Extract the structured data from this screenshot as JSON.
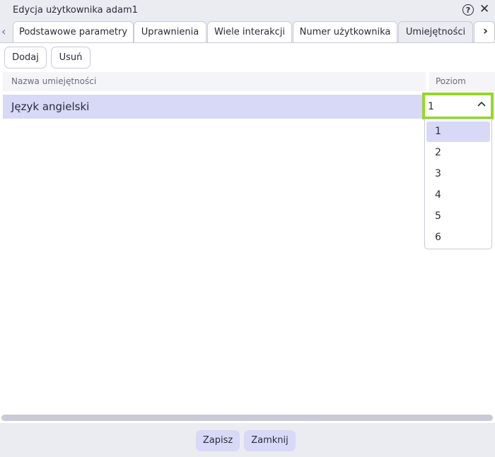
{
  "window": {
    "title": "Edycja użytkownika adam1",
    "help_glyph": "?",
    "close_glyph": "✕"
  },
  "tabs": [
    {
      "label": "Podstawowe parametry",
      "active": false
    },
    {
      "label": "Uprawnienia",
      "active": false
    },
    {
      "label": "Wiele interakcji",
      "active": false
    },
    {
      "label": "Numer użytkownika",
      "active": false
    },
    {
      "label": "Umiejętności",
      "active": true
    }
  ],
  "tab_nav": {
    "left_glyph": "‹",
    "right_glyph": "›"
  },
  "toolbar": {
    "add_label": "Dodaj",
    "remove_label": "Usuń"
  },
  "grid": {
    "columns": [
      "Nazwa umiejętności",
      "Poziom"
    ],
    "rows": [
      {
        "name": "Język angielski",
        "level": "1"
      }
    ]
  },
  "level_select": {
    "value": "1",
    "chevron_glyph": "^",
    "options": [
      "1",
      "2",
      "3",
      "4",
      "5",
      "6"
    ],
    "selected_index": 0
  },
  "footer": {
    "save_label": "Zapisz",
    "close_label": "Zamknij"
  },
  "colors": {
    "accent": "#96d825",
    "selection": "#d7d9f7",
    "chrome": "#ebecf2"
  }
}
